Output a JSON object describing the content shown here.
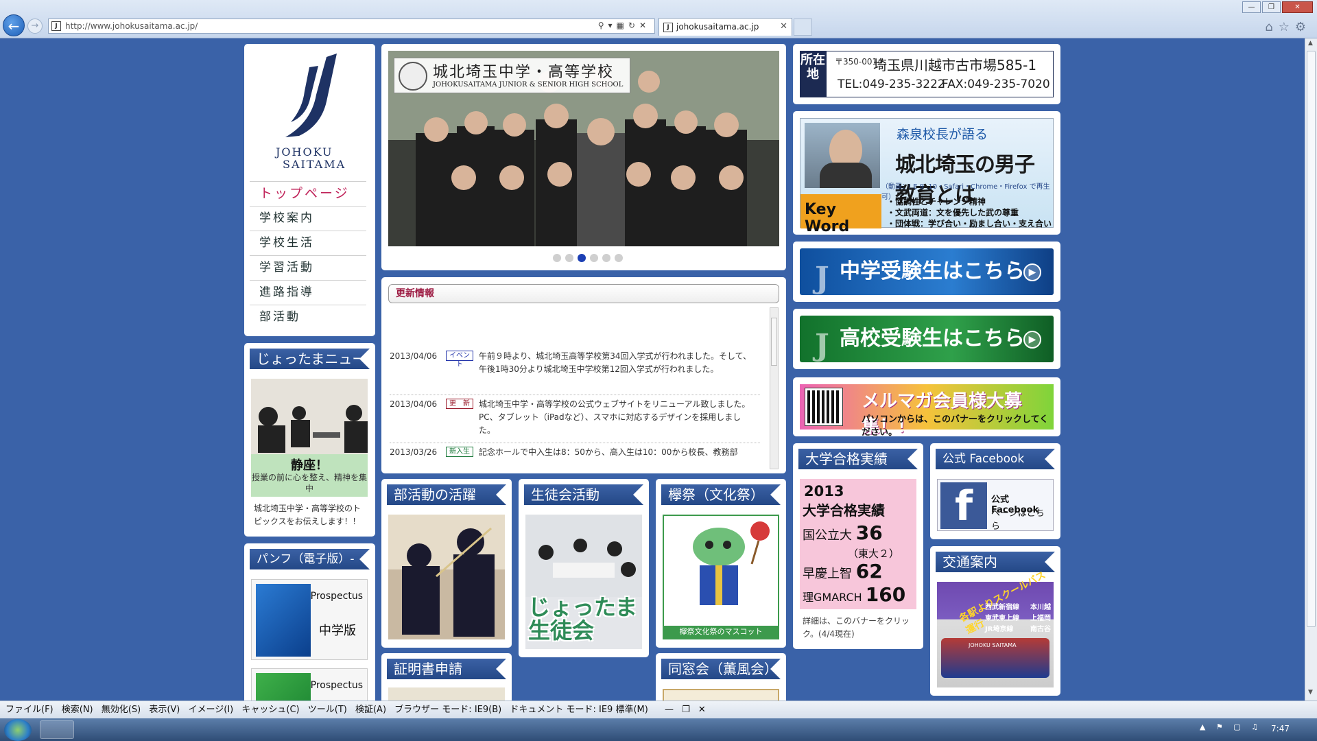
{
  "browser": {
    "url": "http://www.johokusaitama.ac.jp/",
    "tab_title": "johokusaitama.ac.jp"
  },
  "sidebar": {
    "logo_line1": "JOHOKU",
    "logo_line2": "SAITAMA",
    "nav": [
      "トップページ",
      "学校案内",
      "学校生活",
      "学習活動",
      "進路指導",
      "部活動"
    ],
    "news_title": "じょったまニュース",
    "news_caption_title": "静座！",
    "news_caption_sub": "授業の前に心を整え、精神を集中",
    "news_text": "城北埼玉中学・高等学校のトピックスをお伝えします！！",
    "pamph_title": "パンフ（電子版）-PDF-",
    "pamph_items": [
      {
        "label": "Prospectus",
        "kind": "中学版"
      },
      {
        "label": "Prospectus",
        "kind": ""
      }
    ]
  },
  "hero": {
    "title": "城北埼玉中学・高等学校",
    "subtitle": "JOHOKUSAITAMA JUNIOR & SENIOR HIGH SCHOOL",
    "slide_count": 6,
    "active_slide": 3
  },
  "news": {
    "header": "更新情報",
    "items": [
      {
        "date": "2013/04/06",
        "tag": "イベント",
        "text": "午前９時より、城北埼玉高等学校第34回入学式が行われました。そして、午後1時30分より城北埼玉中学校第12回入学式が行われました。"
      },
      {
        "date": "2013/04/06",
        "tag": "更　新",
        "text": "城北埼玉中学・高等学校の公式ウェブサイトをリニューアル致しました。PC、タブレット（iPadなど）、スマホに対応するデザインを採用しました。"
      },
      {
        "date": "2013/03/26",
        "tag": "新入生",
        "text": "記念ホールで中入生は8：50から、高入生は10：00から校長、教務部"
      }
    ]
  },
  "address": {
    "tag": "所在地",
    "zip": "〒350-0014",
    "line": "埼玉県川越市古市場585-1",
    "tel": "TEL:049-235-3222",
    "fax": "FAX:049-235-7020"
  },
  "principal": {
    "heading": "森泉校長が語る",
    "title": "城北埼玉の男子教育とは",
    "note": "（動画：I.E 9 ,10・Safari・Chrome・Firefox で再生可）",
    "keyword": "Key Word",
    "points": [
      "・協調性とチャレンジ精神",
      "・文武両道：文を優先した武の尊重",
      "・団体戦：学び合い・励まし合い・支え合い"
    ]
  },
  "buttons": {
    "junior": "中学受験生はこちら",
    "senior": "高校受験生はこちら"
  },
  "mailmag": {
    "title": "メルマガ会員様大募集！！",
    "sub": "パソコンからは、このバナーをクリックしてください。"
  },
  "university": {
    "header": "大学合格実績",
    "year": "2013",
    "label": "大学合格実績",
    "rows": [
      {
        "name": "国公立大",
        "count": "36"
      },
      {
        "name": "（東大２）",
        "count": ""
      },
      {
        "name": "早慶上智",
        "count": "62"
      },
      {
        "name": "理GMARCH",
        "count": "160"
      }
    ],
    "note": "詳細は、このバナーをクリック。(4/4現在)"
  },
  "facebook": {
    "header": "公式 Facebook",
    "line1": "公式 Facebook",
    "line2": "ページはこちら"
  },
  "traffic": {
    "header": "交通案内",
    "banner": "各駅よりスクールバス運行",
    "stops": [
      "西武新宿線",
      "本川越",
      "東武東上線",
      "上福岡",
      "JR埼京線",
      "南古谷"
    ],
    "bus_label": "JOHOKU SAITAMA"
  },
  "middle": {
    "club": "部活動の活躍",
    "student": "生徒会活動",
    "student_caption": "じょったま生徒会",
    "festival": "欅祭（文化祭）",
    "festival_caption": "欅祭文化祭のマスコット",
    "cert": "証明書申請",
    "alumni": "同窓会（薫風会）"
  },
  "cmdbar": [
    "ファイル(F)",
    "検索(N)",
    "無効化(S)",
    "表示(V)",
    "イメージ(I)",
    "キャッシュ(C)",
    "ツール(T)",
    "検証(A)",
    "ブラウザー モード: IE9(B)",
    "ドキュメント モード: IE9 標準(M)"
  ],
  "taskbar": {
    "clock": "7:47"
  },
  "colors": {
    "background": "#3a62a8",
    "header": "#244887",
    "accent": "#c0245a"
  }
}
